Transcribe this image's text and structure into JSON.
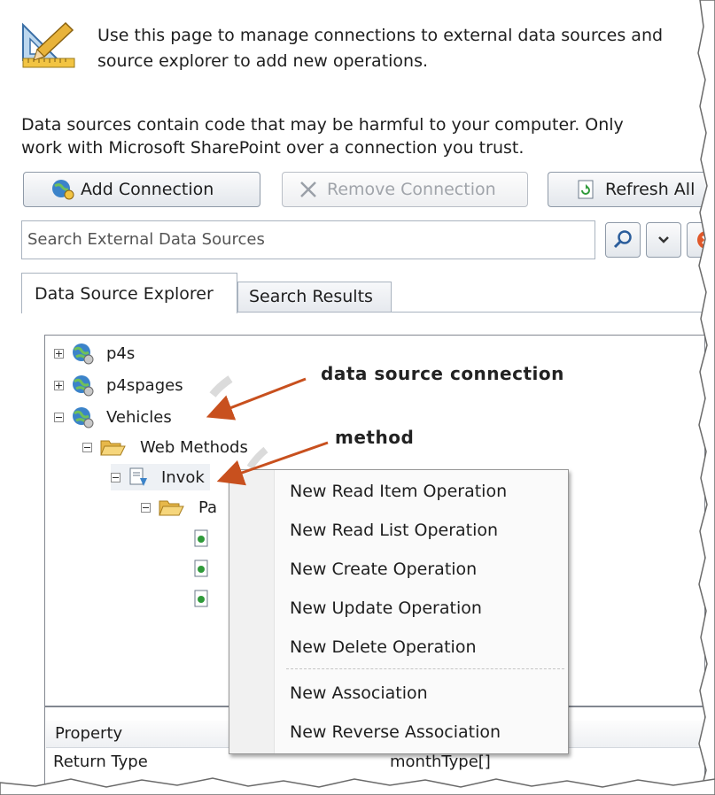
{
  "header": {
    "intro_text": "Use this page to manage connections to external data sources and\nsource explorer to add new operations.",
    "warning_text": "Data sources contain code that may be harmful to your computer. Only\nwork with Microsoft SharePoint over a connection you trust."
  },
  "toolbar": {
    "add_connection_label": "Add Connection",
    "remove_connection_label": "Remove Connection",
    "refresh_all_label": "Refresh All"
  },
  "search": {
    "placeholder": "Search External Data Sources"
  },
  "tabs": [
    {
      "label": "Data Source Explorer",
      "active": true
    },
    {
      "label": "Search Results",
      "active": false
    }
  ],
  "tree": {
    "items": [
      {
        "label": "p4s"
      },
      {
        "label": "p4spages"
      },
      {
        "label": "Vehicles"
      },
      {
        "label": "Web Methods"
      },
      {
        "label": "Invok"
      },
      {
        "label": "Pa"
      }
    ]
  },
  "annotations": {
    "connection_label": "data source connection",
    "method_label": "method"
  },
  "context_menu": {
    "items": [
      "New Read Item Operation",
      "New Read List Operation",
      "New Create Operation",
      "New Update Operation",
      "New Delete Operation",
      "New Association",
      "New Reverse Association"
    ]
  },
  "properties": {
    "header_label": "Property",
    "rows": [
      {
        "name": "Return Type",
        "value": "monthType[]"
      }
    ]
  },
  "colors": {
    "annotation_arrow": "#c8501e",
    "tab_border": "#a9b3bf",
    "menu_bg": "#fafafa"
  }
}
